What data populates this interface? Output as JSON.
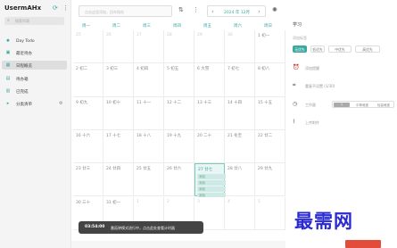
{
  "sidebar": {
    "username": "UsermAHx",
    "search_placeholder": "搜索列表",
    "items": [
      {
        "icon": "sun-icon",
        "label": "Day Todo"
      },
      {
        "icon": "calendar-icon",
        "label": "最近待办"
      },
      {
        "icon": "grid-icon",
        "label": "日程概览"
      },
      {
        "icon": "inbox-icon",
        "label": "待办箱"
      },
      {
        "icon": "archive-icon",
        "label": "已完成"
      },
      {
        "icon": "folder-icon",
        "label": "分类清单"
      }
    ]
  },
  "toolbar": {
    "search_placeholder": "点击这里添加，回车保存",
    "month_label": "2024 年 12月"
  },
  "calendar": {
    "weekdays": [
      "周一",
      "周二",
      "周三",
      "周四",
      "周五",
      "周六",
      "周日"
    ],
    "rows": [
      [
        {
          "d": "25",
          "f": true
        },
        {
          "d": "26",
          "f": true
        },
        {
          "d": "27",
          "f": true
        },
        {
          "d": "28",
          "f": true
        },
        {
          "d": "29",
          "f": true
        },
        {
          "d": "30",
          "f": true
        },
        {
          "d": "1 初一"
        }
      ],
      [
        {
          "d": "2 初二"
        },
        {
          "d": "3 初三"
        },
        {
          "d": "4 初四"
        },
        {
          "d": "5 初五"
        },
        {
          "d": "6 大雪"
        },
        {
          "d": "7 初七"
        },
        {
          "d": "8 初八"
        }
      ],
      [
        {
          "d": "9 初九"
        },
        {
          "d": "10 初十"
        },
        {
          "d": "11 十一"
        },
        {
          "d": "12 十二"
        },
        {
          "d": "13 十三"
        },
        {
          "d": "14 十四"
        },
        {
          "d": "15 十五"
        }
      ],
      [
        {
          "d": "16 十六"
        },
        {
          "d": "17 十七"
        },
        {
          "d": "18 十八"
        },
        {
          "d": "19 十九"
        },
        {
          "d": "20 二十"
        },
        {
          "d": "21 冬至"
        },
        {
          "d": "22 廿二"
        }
      ],
      [
        {
          "d": "23 廿三"
        },
        {
          "d": "24 廿四"
        },
        {
          "d": "25 廿五"
        },
        {
          "d": "26 廿六"
        },
        {
          "d": "27 廿七",
          "today": true
        },
        {
          "d": "28 廿八"
        },
        {
          "d": "29 廿九"
        }
      ],
      [
        {
          "d": "30 三十"
        },
        {
          "d": "31 初一"
        },
        {
          "d": "1",
          "f": true
        },
        {
          "d": "2",
          "f": true
        },
        {
          "d": "3",
          "f": true
        },
        {
          "d": "4",
          "f": true
        },
        {
          "d": "5",
          "f": true
        }
      ]
    ],
    "today_events": [
      "添加",
      "添加",
      "添加",
      "添加"
    ]
  },
  "panel": {
    "title": "学习",
    "priority_label": "添加标签",
    "chips": [
      "无优先",
      "低优先",
      "中优先",
      "高优先"
    ],
    "reminder": "添加提醒",
    "repeat": "重复不设置 (1/30)",
    "workload_label": "工作量",
    "workload_opts": [
      "1",
      "中等难度",
      "较高难度"
    ],
    "attach": "上传附件"
  },
  "toast": {
    "time": "03:54:00",
    "message": "番茄钟模式进行中，点击此处查看计时器"
  },
  "watermark": "最需网"
}
